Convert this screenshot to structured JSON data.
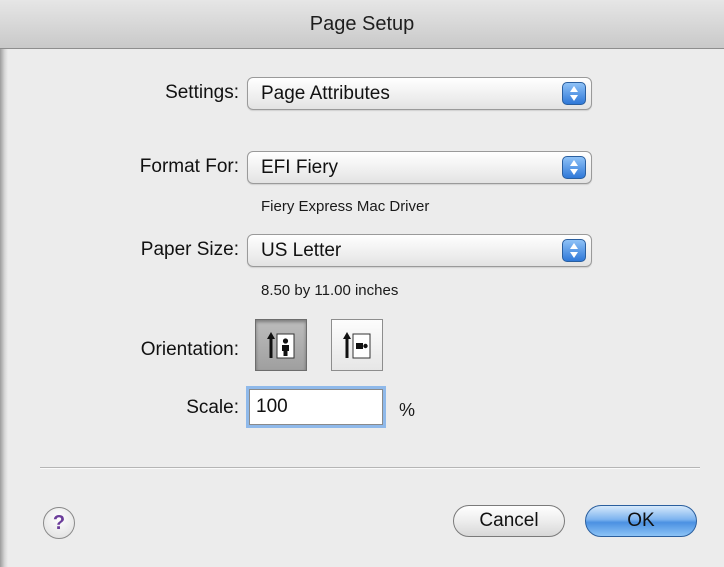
{
  "window": {
    "title": "Page Setup"
  },
  "settings": {
    "label": "Settings:",
    "value": "Page Attributes"
  },
  "format_for": {
    "label": "Format For:",
    "value": "EFI Fiery",
    "detail": "Fiery Express Mac Driver"
  },
  "paper_size": {
    "label": "Paper Size:",
    "value": "US Letter",
    "detail": "8.50 by 11.00 inches"
  },
  "orientation": {
    "label": "Orientation:",
    "selected": "portrait",
    "options": [
      "portrait",
      "landscape"
    ]
  },
  "scale": {
    "label": "Scale:",
    "value": "100",
    "unit": "%"
  },
  "buttons": {
    "help": "?",
    "cancel": "Cancel",
    "ok": "OK"
  },
  "colors": {
    "accent": "#4b91e2",
    "help_text": "#6b3d9a",
    "focus_ring": "#8fb9ea"
  }
}
